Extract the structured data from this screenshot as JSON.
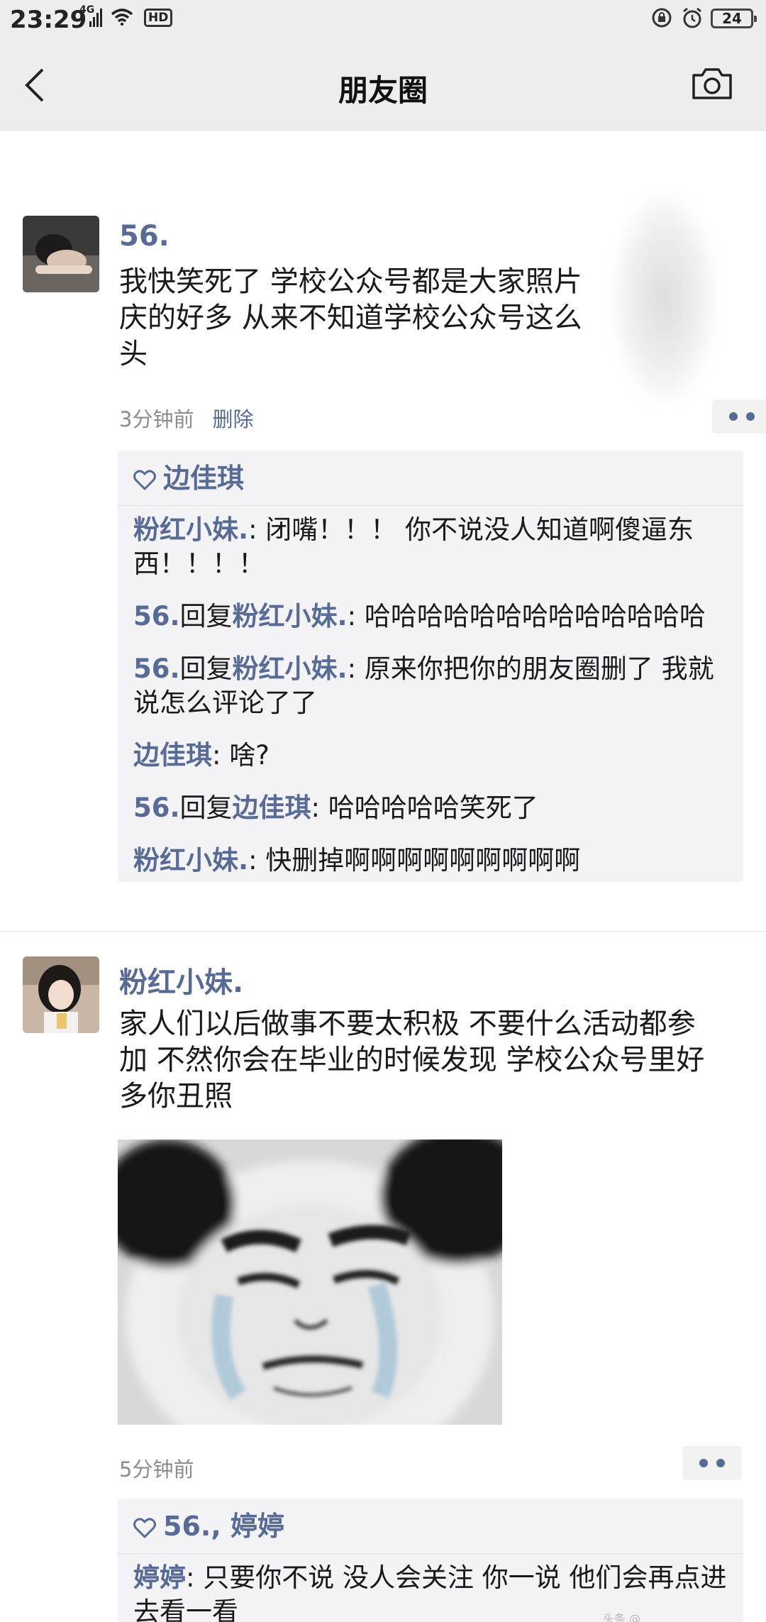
{
  "status_bar": {
    "time": "23:29",
    "network": "4G",
    "hd_label": "HD",
    "battery": "24",
    "icons": [
      "signal-bars-icon",
      "wifi-icon",
      "lock-rotation-icon",
      "alarm-icon",
      "battery-icon"
    ]
  },
  "nav": {
    "title": "朋友圈",
    "back_icon": "chevron-left-icon",
    "camera_icon": "camera-icon"
  },
  "posts": [
    {
      "username": "56.",
      "text_line1": "我快笑死了 学校公众号都是大家照片",
      "text_line2": "庆的好多 从来不知道学校公众号这么",
      "text_line3": "头",
      "time": "3分钟前",
      "delete_label": "删除",
      "likes": "边佳琪",
      "comments": [
        {
          "author": "粉红小妹.",
          "sep": ": ",
          "text": "闭嘴！！！ 你不说没人知道啊傻逼东西！！！！"
        },
        {
          "author": "56.",
          "reply_word": "回复",
          "target": "粉红小妹.",
          "sep": ": ",
          "text": "哈哈哈哈哈哈哈哈哈哈哈哈哈"
        },
        {
          "author": "56.",
          "reply_word": "回复",
          "target": "粉红小妹.",
          "sep": ": ",
          "text": "原来你把你的朋友圈删了 我就说怎么评论了了"
        },
        {
          "author": "边佳琪",
          "sep": ": ",
          "text": "啥?"
        },
        {
          "author": "56.",
          "reply_word": "回复",
          "target": "边佳琪",
          "sep": ": ",
          "text": "哈哈哈哈哈笑死了"
        },
        {
          "author": "粉红小妹.",
          "sep": ": ",
          "text": "快删掉啊啊啊啊啊啊啊啊啊"
        }
      ]
    },
    {
      "username": "粉红小妹.",
      "text": "家人们以后做事不要太积极 不要什么活动都参加 不然你会在毕业的时候发现 学校公众号里好多你丑照",
      "time": "5分钟前",
      "likes": "56., 婷婷",
      "comments": [
        {
          "author": "婷婷",
          "sep": ": ",
          "text": "只要你不说 没人会关注 你一说 他们会再点进去看一看"
        }
      ]
    }
  ]
}
